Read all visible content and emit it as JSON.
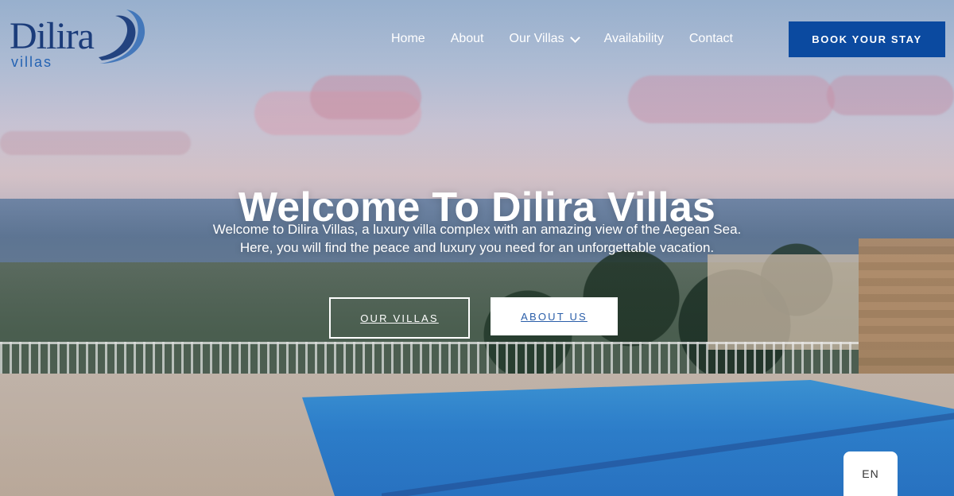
{
  "brand": {
    "name": "Dilira",
    "subtitle": "villas",
    "colors": {
      "primary": "#1b3c7a",
      "accent": "#2463b3"
    }
  },
  "nav": {
    "items": [
      {
        "label": "Home"
      },
      {
        "label": "About"
      },
      {
        "label": "Our Villas",
        "has_dropdown": true
      },
      {
        "label": "Availability"
      },
      {
        "label": "Contact"
      }
    ],
    "cta_label": "BOOK YOUR STAY",
    "cta_color": "#0b4aa0"
  },
  "hero": {
    "title": "Welcome To Dilira Villas",
    "subtitle_line1": "Welcome to Dilira Villas, a luxury villa complex with an amazing view of the Aegean Sea.",
    "subtitle_line2": "Here, you will find the peace and luxury you need for an unforgettable vacation.",
    "buttons": {
      "outline": "OUR VILLAS",
      "solid": "ABOUT US"
    }
  },
  "language": {
    "current": "EN"
  },
  "icons": {
    "logo_wave": "wave-logo-icon",
    "dropdown": "chevron-down-icon"
  }
}
